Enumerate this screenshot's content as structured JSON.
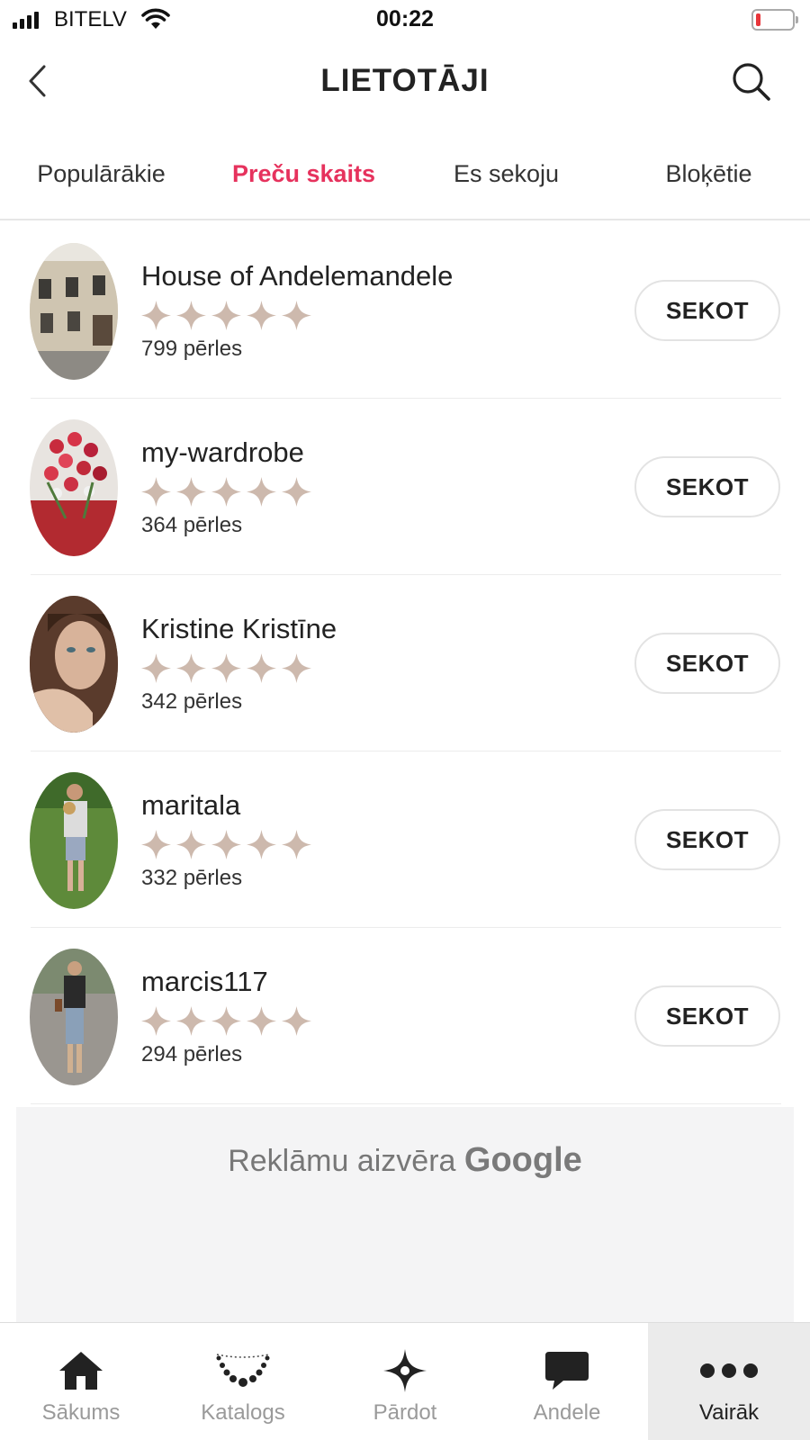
{
  "status_bar": {
    "carrier": "BITELV",
    "time": "00:22"
  },
  "header": {
    "title": "LIETOTĀJI"
  },
  "tabs": [
    {
      "label": "Populārākie",
      "active": false
    },
    {
      "label": "Preču skaits",
      "active": true
    },
    {
      "label": "Es sekoju",
      "active": false
    },
    {
      "label": "Bloķētie",
      "active": false
    }
  ],
  "users": [
    {
      "name": "House of Andelemandele",
      "rating": 5,
      "pearls": "799 pērles",
      "follow_label": "SEKOT"
    },
    {
      "name": "my-wardrobe",
      "rating": 5,
      "pearls": "364 pērles",
      "follow_label": "SEKOT"
    },
    {
      "name": "Kristine Kristīne",
      "rating": 5,
      "pearls": "342 pērles",
      "follow_label": "SEKOT"
    },
    {
      "name": "maritala",
      "rating": 5,
      "pearls": "332 pērles",
      "follow_label": "SEKOT"
    },
    {
      "name": "marcis117",
      "rating": 5,
      "pearls": "294 pērles",
      "follow_label": "SEKOT"
    }
  ],
  "ad": {
    "text": "Reklāmu aizvēra",
    "brand": "Google"
  },
  "bottom_nav": [
    {
      "label": "Sākums",
      "icon": "home-icon",
      "active": false
    },
    {
      "label": "Katalogs",
      "icon": "necklace-icon",
      "active": false
    },
    {
      "label": "Pārdot",
      "icon": "sparkle-icon",
      "active": false
    },
    {
      "label": "Andele",
      "icon": "chat-bubble-icon",
      "active": false
    },
    {
      "label": "Vairāk",
      "icon": "more-dots-icon",
      "active": true
    }
  ],
  "colors": {
    "accent": "#e6325d",
    "star": "#cdb9ad",
    "battery_low": "#e8353a"
  }
}
